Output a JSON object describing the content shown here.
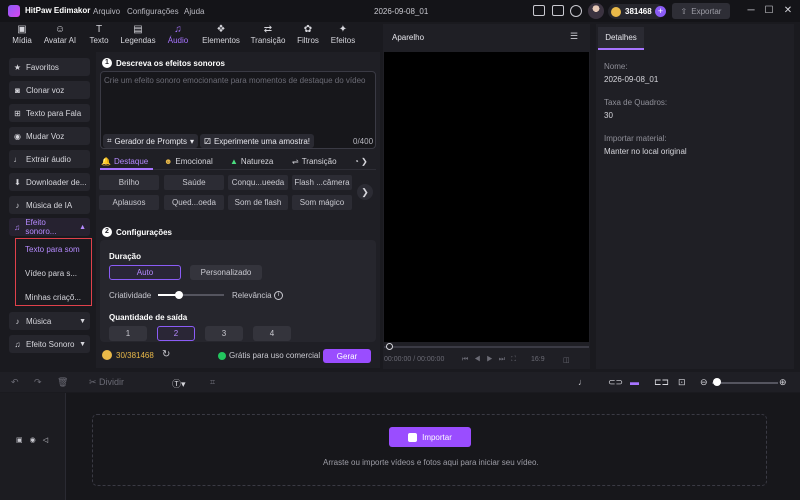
{
  "app": {
    "name": "HitPaw Edimakor",
    "doc_title": "2026-09-08_01",
    "credits": "381468",
    "export_label": "Exportar"
  },
  "menu": [
    "Arquivo",
    "Configurações",
    "Ajuda"
  ],
  "tabs": [
    {
      "label": "Mídia",
      "icon": "media-icon"
    },
    {
      "label": "Avatar AI",
      "icon": "avatar-icon"
    },
    {
      "label": "Texto",
      "icon": "text-icon"
    },
    {
      "label": "Legendas",
      "icon": "captions-icon"
    },
    {
      "label": "Áudio",
      "icon": "audio-icon",
      "active": true
    },
    {
      "label": "Elementos",
      "icon": "elements-icon"
    },
    {
      "label": "Transição",
      "icon": "transition-icon"
    },
    {
      "label": "Filtros",
      "icon": "filters-icon"
    },
    {
      "label": "Efeitos",
      "icon": "effects-icon"
    }
  ],
  "sidebar": {
    "items": [
      "Favoritos",
      "Clonar voz",
      "Texto para Fala",
      "Mudar Voz",
      "Extrair áudio",
      "Downloader de...",
      "Música de IA",
      "Efeito sonoro...",
      "Música",
      "Efeito Sonoro"
    ],
    "submenu": [
      "Texto para som",
      "Vídeo para s...",
      "Minhas criaçõ..."
    ]
  },
  "section1": {
    "title": "Descreva os efeitos sonoros",
    "placeholder": "Crie um efeito sonoro emocionante para momentos de destaque do vídeo",
    "prompt_gen": "Gerador de Prompts",
    "try_sample": "Experimente uma amostra!",
    "counter": "0/400"
  },
  "categories": [
    "Destaque",
    "Emocional",
    "Natureza",
    "Transição"
  ],
  "chips": [
    "Brilho",
    "Saúde",
    "Conqu...ueeda",
    "Flash ...câmera",
    "Aplausos",
    "Qued...oeda",
    "Som de flash",
    "Som mágico"
  ],
  "section2": {
    "title": "Configurações",
    "duration_label": "Duração",
    "auto": "Auto",
    "custom": "Personalizado",
    "creativity": "Criatividade",
    "relevance": "Relevância",
    "qty_label": "Quantidade de saída",
    "qty": [
      "1",
      "2",
      "3",
      "4"
    ],
    "credits": "30/381468",
    "free": "Grátis para uso comercial",
    "generate": "Gerar"
  },
  "preview": {
    "title": "Aparelho",
    "time": "00:00:00 / 00:00:00",
    "ratio": "16:9"
  },
  "details": {
    "tab": "Detalhes",
    "name_label": "Nome:",
    "name_val": "2026-09-08_01",
    "fps_label": "Taxa de Quadros:",
    "fps_val": "30",
    "import_label": "Importar material:",
    "import_val": "Manter no local original"
  },
  "timeline": {
    "divide": "Dividir",
    "import": "Importar",
    "hint": "Arraste ou importe vídeos e fotos aqui para iniciar seu vídeo."
  }
}
